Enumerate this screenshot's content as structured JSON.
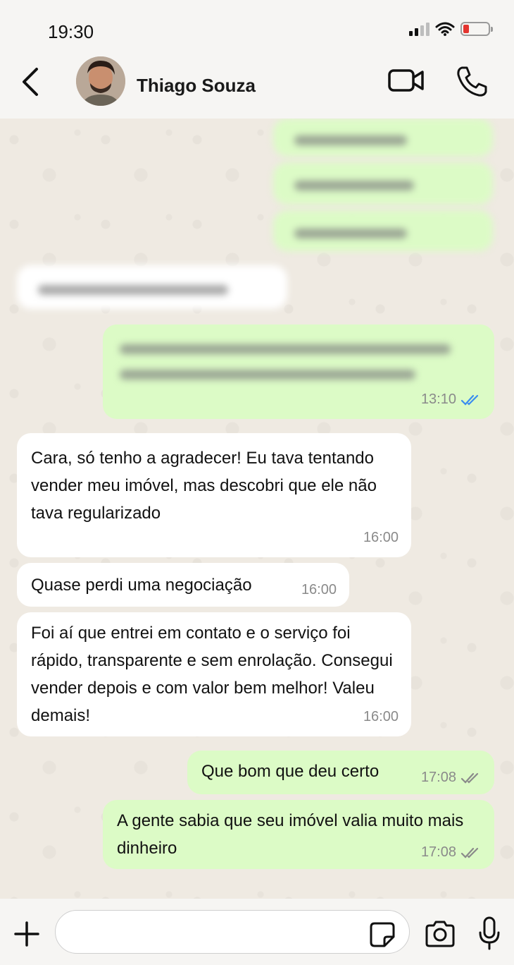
{
  "status_bar": {
    "time": "19:30"
  },
  "header": {
    "contact_name": "Thiago Souza",
    "icons": [
      "back-chevron-icon",
      "video-camera-icon",
      "phone-icon"
    ]
  },
  "messages": [
    {
      "direction": "out",
      "text": "",
      "time": "",
      "blurred": true
    },
    {
      "direction": "out",
      "text": "",
      "time": "",
      "blurred": true
    },
    {
      "direction": "out",
      "text": "",
      "time": "",
      "blurred": true
    },
    {
      "direction": "in",
      "text": "",
      "time": "",
      "blurred": true
    },
    {
      "direction": "out",
      "text": "",
      "time": "13:10",
      "blurred": true,
      "status": "read"
    },
    {
      "direction": "in",
      "text": "Cara, só tenho a agradecer! Eu tava tentando vender meu imóvel, mas descobri que ele não tava regularizado",
      "time": "16:00"
    },
    {
      "direction": "in",
      "text": "Quase perdi uma negociação",
      "time": "16:00"
    },
    {
      "direction": "in",
      "text": "Foi aí que entrei em contato e o serviço foi rápido, transparente e sem enrolação. Consegui vender depois e com valor bem melhor! Valeu demais!",
      "time": "16:00"
    },
    {
      "direction": "out",
      "text": "Que bom que deu certo",
      "time": "17:08",
      "status": "delivered"
    },
    {
      "direction": "out",
      "text": "A gente sabia que seu imóvel valia muito mais dinheiro",
      "time": "17:08",
      "status": "delivered"
    }
  ],
  "input_bar": {
    "placeholder": "",
    "icons": [
      "plus-icon",
      "sticker-icon",
      "camera-icon",
      "microphone-icon"
    ]
  },
  "colors": {
    "incoming_bubble": "#ffffff",
    "outgoing_bubble": "#dcfbc6",
    "read_ticks": "#3b8df0",
    "delivered_ticks": "#8a8a8a",
    "battery_low": "#e3342f"
  }
}
